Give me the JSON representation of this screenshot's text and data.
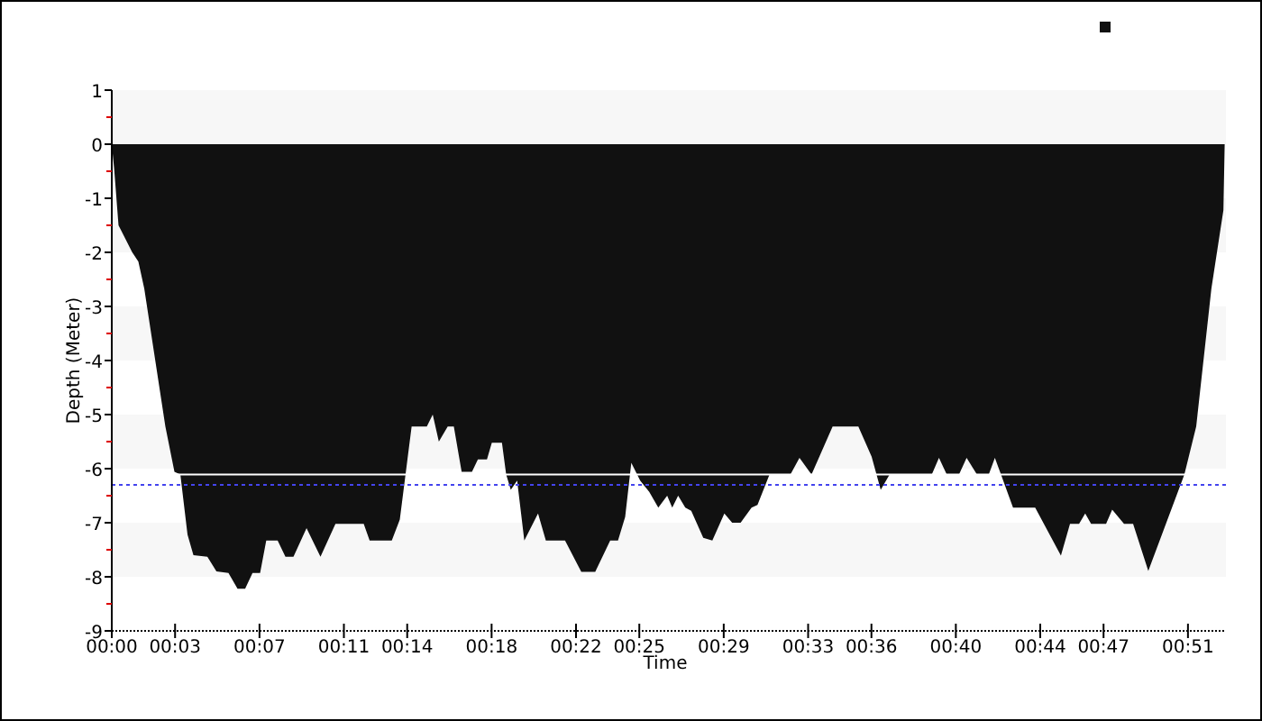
{
  "chart_data": {
    "type": "area",
    "xlabel": "Time",
    "ylabel": "Depth (Meter)",
    "series": [
      {
        "color": "#111111",
        "x": [
          0,
          0.11,
          0.32,
          0.97,
          1.26,
          1.54,
          2.54,
          2.97,
          3.25,
          3.59,
          3.87,
          4.53,
          4.96,
          5.53,
          5.96,
          6.32,
          6.67,
          7.03,
          7.32,
          7.86,
          8.23,
          8.61,
          9.23,
          9.89,
          10.6,
          11.94,
          12.22,
          13.27,
          13.65,
          14.21,
          14.93,
          15.21,
          15.5,
          15.92,
          16.21,
          16.58,
          17.07,
          17.35,
          17.78,
          18.01,
          18.49,
          18.69,
          18.91,
          19.21,
          19.55,
          20.2,
          20.57,
          21.48,
          22.25,
          22.91,
          23.62,
          23.99,
          24.33,
          24.62,
          25.04,
          25.47,
          25.9,
          26.32,
          26.56,
          26.84,
          27.18,
          27.46,
          28.03,
          28.46,
          29.03,
          29.4,
          29.8,
          30.32,
          30.6,
          31.17,
          32.16,
          32.59,
          33.16,
          34.16,
          35.38,
          36.01,
          36.44,
          36.86,
          38.86,
          39.2,
          39.57,
          40.15,
          40.51,
          41.0,
          41.56,
          41.85,
          42.14,
          42.71,
          43.76,
          44.98,
          45.41,
          45.84,
          46.13,
          46.41,
          47.12,
          47.41,
          47.97,
          48.4,
          49.12,
          50.83,
          51.39,
          52.11,
          52.68,
          52.74
        ],
        "values": [
          0,
          -0.44,
          -1.5,
          -2.0,
          -2.17,
          -2.67,
          -5.22,
          -6.06,
          -6.11,
          -7.22,
          -7.6,
          -7.63,
          -7.9,
          -7.93,
          -8.22,
          -8.22,
          -7.93,
          -7.93,
          -7.33,
          -7.33,
          -7.63,
          -7.63,
          -7.1,
          -7.63,
          -7.02,
          -7.02,
          -7.33,
          -7.33,
          -6.94,
          -5.22,
          -5.22,
          -5.0,
          -5.5,
          -5.22,
          -5.22,
          -6.06,
          -6.06,
          -5.83,
          -5.83,
          -5.52,
          -5.52,
          -6.11,
          -6.39,
          -6.22,
          -7.33,
          -6.83,
          -7.33,
          -7.33,
          -7.91,
          -7.91,
          -7.33,
          -7.33,
          -6.89,
          -5.89,
          -6.22,
          -6.43,
          -6.72,
          -6.5,
          -6.72,
          -6.5,
          -6.72,
          -6.78,
          -7.28,
          -7.33,
          -6.83,
          -7.0,
          -7.0,
          -6.72,
          -6.67,
          -6.11,
          -6.11,
          -5.8,
          -6.11,
          -5.22,
          -5.22,
          -5.78,
          -6.39,
          -6.11,
          -6.11,
          -5.8,
          -6.11,
          -6.11,
          -5.8,
          -6.11,
          -6.11,
          -5.8,
          -6.11,
          -6.72,
          -6.72,
          -7.61,
          -7.02,
          -7.02,
          -6.83,
          -7.02,
          -7.02,
          -6.76,
          -7.02,
          -7.02,
          -7.89,
          -6.11,
          -5.22,
          -2.67,
          -1.22,
          0
        ]
      }
    ],
    "xlim": [
      0,
      52.8
    ],
    "ylim": [
      -9,
      1
    ],
    "xticks": [
      {
        "value": 0,
        "label": "00:00"
      },
      {
        "value": 3,
        "label": "00:03"
      },
      {
        "value": 7,
        "label": "00:07"
      },
      {
        "value": 11,
        "label": "00:11"
      },
      {
        "value": 14,
        "label": "00:14"
      },
      {
        "value": 18,
        "label": "00:18"
      },
      {
        "value": 22,
        "label": "00:22"
      },
      {
        "value": 25,
        "label": "00:25"
      },
      {
        "value": 29,
        "label": "00:29"
      },
      {
        "value": 33,
        "label": "00:33"
      },
      {
        "value": 36,
        "label": "00:36"
      },
      {
        "value": 40,
        "label": "00:40"
      },
      {
        "value": 44,
        "label": "00:44"
      },
      {
        "value": 47,
        "label": "00:47"
      },
      {
        "value": 51,
        "label": "00:51"
      }
    ],
    "yticks": [
      1,
      0,
      -1,
      -2,
      -3,
      -4,
      -5,
      -6,
      -7,
      -8,
      -9
    ],
    "ref_lines": [
      {
        "axis": "y",
        "value": -6.3,
        "color": "#4444ee"
      },
      {
        "axis": "y",
        "value": -6.11,
        "color": "#ffffff"
      }
    ]
  }
}
